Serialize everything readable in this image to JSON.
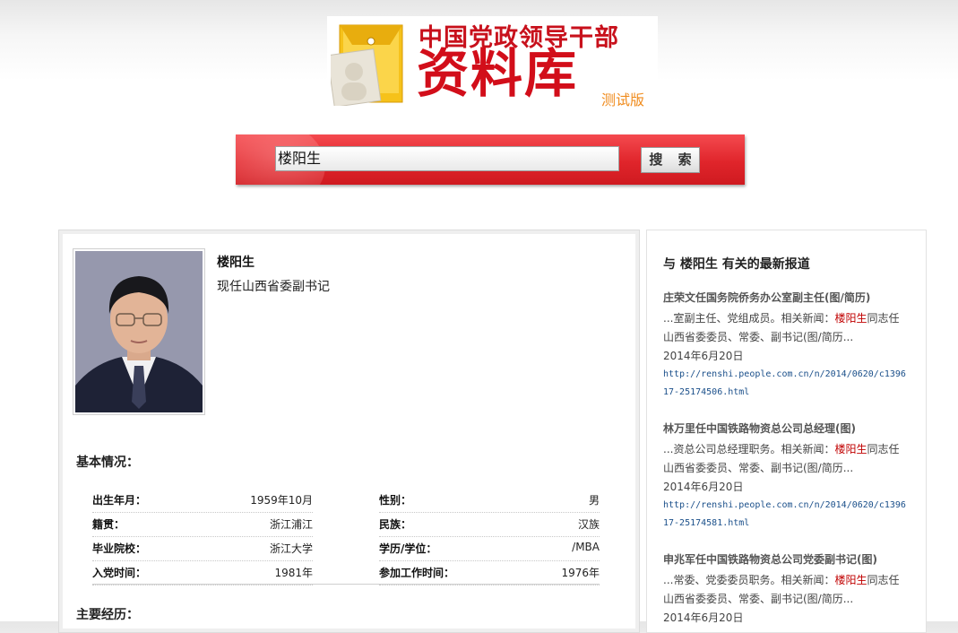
{
  "logo": {
    "line1": "中国党政领导干部",
    "line2": "资料库",
    "tag": "测试版"
  },
  "search": {
    "query": "楼阳生",
    "button_label": "搜 索"
  },
  "profile": {
    "name": "楼阳生",
    "position": "现任山西省委副书记",
    "basic_title": "基本情况：",
    "career_title": "主要经历：",
    "info": [
      {
        "label": "出生年月：",
        "value": "1959年10月"
      },
      {
        "label": "性别：",
        "value": "男"
      },
      {
        "label": "籍贯：",
        "value": "浙江浦江"
      },
      {
        "label": "民族：",
        "value": "汉族"
      },
      {
        "label": "毕业院校：",
        "value": "浙江大学"
      },
      {
        "label": "学历/学位：",
        "value": "/MBA"
      },
      {
        "label": "入党时间：",
        "value": "1981年"
      },
      {
        "label": "参加工作时间：",
        "value": "1976年"
      }
    ]
  },
  "news": {
    "header": "与 楼阳生 有关的最新报道",
    "items": [
      {
        "title": "庄荣文任国务院侨务办公室副主任(图/简历)",
        "snippet_pre": "...室副主任、党组成员。相关新闻：",
        "highlight": "楼阳生",
        "snippet_post": "同志任山西省委委员、常委、副书记(图/简历...",
        "date": "2014年6月20日",
        "url": "http://renshi.people.com.cn/n/2014/0620/c139617-25174506.html"
      },
      {
        "title": "林万里任中国铁路物资总公司总经理(图)",
        "snippet_pre": "...资总公司总经理职务。相关新闻：",
        "highlight": "楼阳生",
        "snippet_post": "同志任山西省委委员、常委、副书记(图/简历...",
        "date": "2014年6月20日",
        "url": "http://renshi.people.com.cn/n/2014/0620/c139617-25174581.html"
      },
      {
        "title": "申兆军任中国铁路物资总公司党委副书记(图)",
        "snippet_pre": "...常委、党委委员职务。相关新闻：",
        "highlight": "楼阳生",
        "snippet_post": "同志任山西省委委员、常委、副书记(图/简历...",
        "date": "2014年6月20日",
        "url": ""
      }
    ]
  },
  "colors": {
    "brand_red": "#d20e1a",
    "tag_orange": "#f08c1e",
    "link_blue": "#1a4f8a",
    "highlight_red": "#c00000"
  }
}
